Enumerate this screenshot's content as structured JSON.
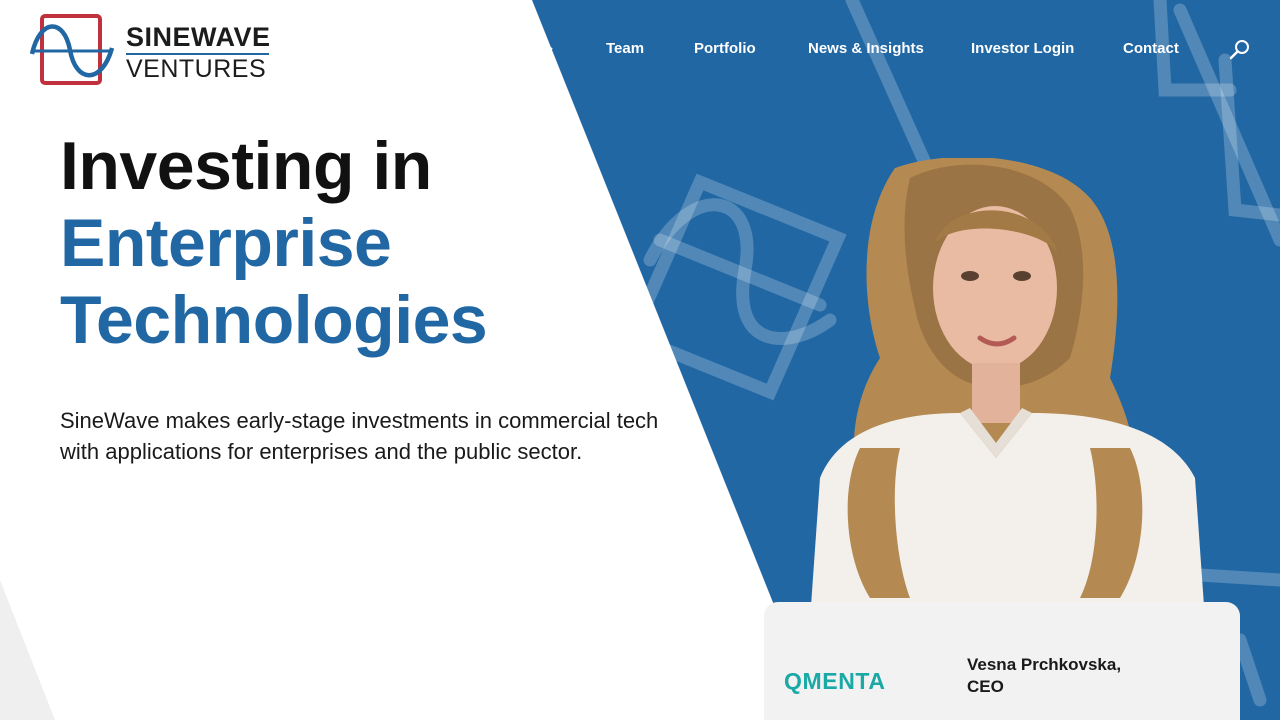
{
  "brand": {
    "name_line1": "SINEWAVE",
    "name_line2": "VENTURES",
    "colors": {
      "blue": "#2067a4",
      "red": "#c0313d",
      "dark": "#1c1c1c"
    }
  },
  "nav": {
    "items": [
      {
        "label": "Team"
      },
      {
        "label": "Portfolio"
      },
      {
        "label": "News & Insights"
      },
      {
        "label": "Investor Login"
      },
      {
        "label": "Contact"
      }
    ],
    "search_icon": "search-icon",
    "dropdown_icon": "chevron-down-icon"
  },
  "hero": {
    "headline_line1": "Investing in",
    "headline_line2": "Enterprise",
    "headline_line3": "Technologies",
    "description": "SineWave makes early-stage investments in commercial tech with applications for enterprises and the public sector."
  },
  "testimonial": {
    "company": "QMENTA",
    "person_line1": "Vesna Prchkovska,",
    "person_line2": "CEO",
    "company_color": "#1aa9a6"
  }
}
